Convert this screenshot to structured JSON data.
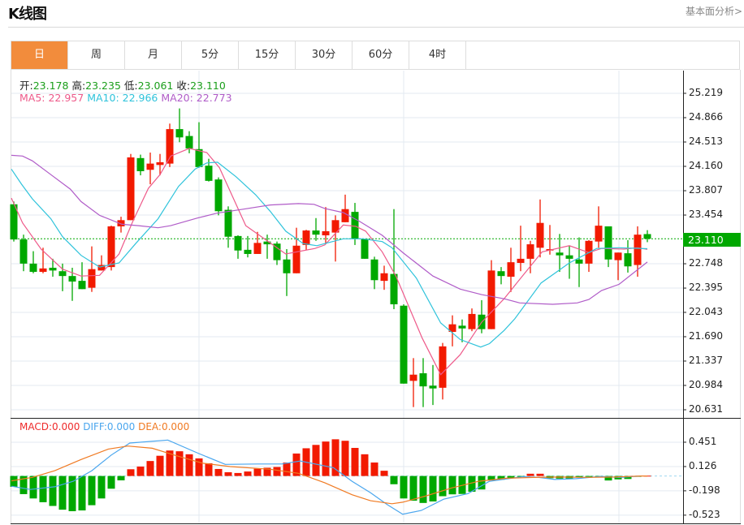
{
  "header": {
    "title": "K线图",
    "fundamental_link": "基本面分析>"
  },
  "tabs": [
    {
      "label": "日",
      "active": true
    },
    {
      "label": "周",
      "active": false
    },
    {
      "label": "月",
      "active": false
    },
    {
      "label": "5分",
      "active": false
    },
    {
      "label": "15分",
      "active": false
    },
    {
      "label": "30分",
      "active": false
    },
    {
      "label": "60分",
      "active": false
    },
    {
      "label": "4时",
      "active": false
    }
  ],
  "ohlc_info": {
    "open_label": "开:",
    "open": "23.178",
    "high_label": "高:",
    "high": "23.235",
    "low_label": "低:",
    "low": "23.061",
    "close_label": "收:",
    "close": "23.110"
  },
  "ma_info": {
    "ma5": "MA5: 22.957",
    "ma10": "MA10: 22.966",
    "ma20": "MA20: 22.773"
  },
  "macd_info": {
    "macd": "MACD:0.000",
    "diff": "DIFF:0.000",
    "dea": "DEA:0.000"
  },
  "colors": {
    "up": "#f21a00",
    "down": "#00a800",
    "ma5": "#ee5a8a",
    "ma10": "#2fc3db",
    "ma20": "#b05cc8",
    "diff": "#4aa6ee",
    "dea": "#f07a22",
    "tab_active": "#f28c3c"
  },
  "chart_data": [
    {
      "type": "candlestick",
      "title": "K线图",
      "current_price": "23.110",
      "yticks": [
        "25.219",
        "24.866",
        "24.513",
        "24.160",
        "23.807",
        "23.454",
        "22.748",
        "22.395",
        "22.043",
        "21.690",
        "21.337",
        "20.984",
        "20.631"
      ],
      "ylim": [
        20.631,
        25.219
      ],
      "candles": [
        [
          23.61,
          23.1,
          23.65,
          23.07
        ],
        [
          23.1,
          22.75,
          23.17,
          22.64
        ],
        [
          22.75,
          22.63,
          22.93,
          22.61
        ],
        [
          22.63,
          22.68,
          22.98,
          22.61
        ],
        [
          22.69,
          22.65,
          22.82,
          22.56
        ],
        [
          22.64,
          22.57,
          22.75,
          22.35
        ],
        [
          22.57,
          22.49,
          22.69,
          22.21
        ],
        [
          22.5,
          22.38,
          22.77,
          22.38
        ],
        [
          22.4,
          22.67,
          23.0,
          22.34
        ],
        [
          22.65,
          22.73,
          22.87,
          22.65
        ],
        [
          22.7,
          23.29,
          23.3,
          22.65
        ],
        [
          23.29,
          23.38,
          23.43,
          23.2
        ],
        [
          23.38,
          24.29,
          24.34,
          23.38
        ],
        [
          24.28,
          24.09,
          24.33,
          24.03
        ],
        [
          24.11,
          24.2,
          24.36,
          23.9
        ],
        [
          24.18,
          24.22,
          24.34,
          24.03
        ],
        [
          24.2,
          24.7,
          24.78,
          24.15
        ],
        [
          24.7,
          24.58,
          25.0,
          24.51
        ],
        [
          24.6,
          24.42,
          24.67,
          24.35
        ],
        [
          24.41,
          24.15,
          24.8,
          24.14
        ],
        [
          24.17,
          23.95,
          24.27,
          23.94
        ],
        [
          23.97,
          23.51,
          24.0,
          23.45
        ],
        [
          23.53,
          23.14,
          23.58,
          22.98
        ],
        [
          23.15,
          22.94,
          23.16,
          22.82
        ],
        [
          22.95,
          22.89,
          23.15,
          22.84
        ],
        [
          22.89,
          23.05,
          23.21,
          22.89
        ],
        [
          23.07,
          23.03,
          23.17,
          22.82
        ],
        [
          23.04,
          22.8,
          23.07,
          22.73
        ],
        [
          22.81,
          22.61,
          22.96,
          22.28
        ],
        [
          22.61,
          23.01,
          23.27,
          22.61
        ],
        [
          23.02,
          23.23,
          23.24,
          22.95
        ],
        [
          23.23,
          23.17,
          23.41,
          23.08
        ],
        [
          23.16,
          23.22,
          23.57,
          23.03
        ],
        [
          23.2,
          23.38,
          23.45,
          22.78
        ],
        [
          23.35,
          23.54,
          23.75,
          23.35
        ],
        [
          23.5,
          23.11,
          23.63,
          23.02
        ],
        [
          23.11,
          22.82,
          23.11,
          22.82
        ],
        [
          22.81,
          22.51,
          22.85,
          22.38
        ],
        [
          22.5,
          22.61,
          22.72,
          22.37
        ],
        [
          22.6,
          22.16,
          23.54,
          22.09
        ],
        [
          22.14,
          21.01,
          22.16,
          21.01
        ],
        [
          21.05,
          21.14,
          21.38,
          20.67
        ],
        [
          21.16,
          20.97,
          21.38,
          20.67
        ],
        [
          20.98,
          20.94,
          21.28,
          20.7
        ],
        [
          20.95,
          21.55,
          21.6,
          20.78
        ],
        [
          21.76,
          21.87,
          22.0,
          21.55
        ],
        [
          21.85,
          21.81,
          21.94,
          21.61
        ],
        [
          21.8,
          22.02,
          22.1,
          21.77
        ],
        [
          22.01,
          21.8,
          22.22,
          21.74
        ],
        [
          21.8,
          22.65,
          22.8,
          21.8
        ],
        [
          22.64,
          22.57,
          22.7,
          22.45
        ],
        [
          22.56,
          22.77,
          22.98,
          22.34
        ],
        [
          22.76,
          22.82,
          23.3,
          22.64
        ],
        [
          22.82,
          23.03,
          23.08,
          22.61
        ],
        [
          22.98,
          23.34,
          23.68,
          22.84
        ],
        [
          22.94,
          22.96,
          23.31,
          22.88
        ],
        [
          22.91,
          22.87,
          23.18,
          22.63
        ],
        [
          22.87,
          22.82,
          23.01,
          22.53
        ],
        [
          22.81,
          22.75,
          23.13,
          22.41
        ],
        [
          22.75,
          23.08,
          23.09,
          22.63
        ],
        [
          23.07,
          23.3,
          23.58,
          22.98
        ],
        [
          23.29,
          22.81,
          23.29,
          22.7
        ],
        [
          22.8,
          22.91,
          22.91,
          22.51
        ],
        [
          22.9,
          22.71,
          23.09,
          22.62
        ],
        [
          22.73,
          23.17,
          23.29,
          22.56
        ],
        [
          23.178,
          23.11,
          23.235,
          23.061
        ]
      ],
      "candle_fields": [
        "open",
        "close",
        "high",
        "low"
      ],
      "ma_series": [
        {
          "name": "MA5",
          "points": [
            [
              -0.3,
              23.7
            ],
            [
              0.9,
              23.34
            ],
            [
              2.8,
              22.96
            ],
            [
              5,
              22.67
            ],
            [
              6.9,
              22.57
            ],
            [
              8.8,
              22.58
            ],
            [
              10.8,
              22.89
            ],
            [
              12.2,
              23.36
            ],
            [
              13.8,
              23.84
            ],
            [
              15,
              24.04
            ],
            [
              16.1,
              24.31
            ],
            [
              18,
              24.42
            ],
            [
              19.8,
              24.36
            ],
            [
              21.1,
              24.14
            ],
            [
              23.8,
              23.3
            ],
            [
              26.7,
              23.01
            ],
            [
              27.9,
              22.89
            ],
            [
              30.9,
              22.97
            ],
            [
              31.9,
              23.02
            ],
            [
              33.8,
              23.31
            ],
            [
              35.1,
              23.29
            ],
            [
              36.1,
              23.22
            ],
            [
              37.8,
              22.92
            ],
            [
              39.2,
              22.57
            ],
            [
              41.9,
              21.67
            ],
            [
              43.8,
              21.14
            ],
            [
              45.8,
              21.43
            ],
            [
              48,
              21.9
            ],
            [
              50.3,
              22.24
            ],
            [
              51.9,
              22.52
            ],
            [
              54.2,
              22.92
            ],
            [
              57,
              23.01
            ],
            [
              59,
              22.91
            ],
            [
              60.3,
              22.97
            ],
            [
              62.6,
              22.96
            ],
            [
              64,
              22.98
            ],
            [
              65,
              22.957
            ]
          ]
        },
        {
          "name": "MA10",
          "points": [
            [
              -0.3,
              24.12
            ],
            [
              0.8,
              23.9
            ],
            [
              1.9,
              23.69
            ],
            [
              3.8,
              23.4
            ],
            [
              5,
              23.14
            ],
            [
              6.9,
              22.87
            ],
            [
              8.8,
              22.7
            ],
            [
              10.8,
              22.76
            ],
            [
              12.5,
              23.04
            ],
            [
              14.8,
              23.4
            ],
            [
              16.9,
              23.87
            ],
            [
              18.6,
              24.12
            ],
            [
              19.8,
              24.21
            ],
            [
              20.9,
              24.22
            ],
            [
              22.8,
              24.01
            ],
            [
              24.8,
              23.75
            ],
            [
              26.3,
              23.51
            ],
            [
              27.9,
              23.22
            ],
            [
              29.7,
              23.04
            ],
            [
              31.1,
              23.01
            ],
            [
              31.9,
              23.04
            ],
            [
              33.8,
              23.11
            ],
            [
              35.8,
              23.11
            ],
            [
              37.8,
              23.07
            ],
            [
              38.8,
              22.98
            ],
            [
              41.3,
              22.54
            ],
            [
              43.8,
              21.89
            ],
            [
              45.8,
              21.65
            ],
            [
              47.9,
              21.54
            ],
            [
              48.8,
              21.59
            ],
            [
              50.3,
              21.78
            ],
            [
              51.4,
              21.95
            ],
            [
              54.1,
              22.47
            ],
            [
              57,
              22.76
            ],
            [
              59.8,
              22.97
            ],
            [
              62.1,
              22.98
            ],
            [
              65,
              22.966
            ]
          ]
        },
        {
          "name": "MA20",
          "points": [
            [
              -0.3,
              24.32
            ],
            [
              0.9,
              24.31
            ],
            [
              1.9,
              24.24
            ],
            [
              3.8,
              24.04
            ],
            [
              5.8,
              23.83
            ],
            [
              6.9,
              23.65
            ],
            [
              8.8,
              23.45
            ],
            [
              11.1,
              23.32
            ],
            [
              12.8,
              23.3
            ],
            [
              14.8,
              23.27
            ],
            [
              16.1,
              23.3
            ],
            [
              18.8,
              23.41
            ],
            [
              20.8,
              23.48
            ],
            [
              23.6,
              23.54
            ],
            [
              26.3,
              23.6
            ],
            [
              29.2,
              23.62
            ],
            [
              30.8,
              23.61
            ],
            [
              31.9,
              23.55
            ],
            [
              33.8,
              23.49
            ],
            [
              35.5,
              23.36
            ],
            [
              37.8,
              23.16
            ],
            [
              40,
              22.9
            ],
            [
              43,
              22.57
            ],
            [
              45.8,
              22.38
            ],
            [
              48,
              22.3
            ],
            [
              50.3,
              22.24
            ],
            [
              51.9,
              22.18
            ],
            [
              55.3,
              22.16
            ],
            [
              57.8,
              22.18
            ],
            [
              59,
              22.23
            ],
            [
              60.3,
              22.36
            ],
            [
              62.1,
              22.45
            ],
            [
              65,
              22.773
            ]
          ]
        }
      ]
    },
    {
      "type": "bar",
      "title": "MACD",
      "yticks": [
        "0.451",
        "0.126",
        "-0.198",
        "-0.523"
      ],
      "histogram": [
        -0.144,
        -0.242,
        -0.3,
        -0.35,
        -0.4,
        -0.45,
        -0.47,
        -0.46,
        -0.39,
        -0.3,
        -0.17,
        -0.058,
        0.09,
        0.126,
        0.2,
        0.27,
        0.34,
        0.33,
        0.29,
        0.235,
        0.17,
        0.094,
        0.05,
        0.04,
        0.06,
        0.097,
        0.11,
        0.12,
        0.18,
        0.3,
        0.37,
        0.415,
        0.46,
        0.49,
        0.47,
        0.375,
        0.29,
        0.18,
        0.07,
        -0.11,
        -0.3,
        -0.33,
        -0.36,
        -0.34,
        -0.27,
        -0.245,
        -0.24,
        -0.21,
        -0.18,
        -0.06,
        -0.05,
        -0.025,
        -0.007,
        0.03,
        0.03,
        -0.03,
        -0.035,
        -0.035,
        -0.02,
        -0.01,
        -0.005,
        -0.06,
        -0.045,
        -0.04,
        -0.007,
        0.004
      ],
      "diff": [
        [
          -0.25,
          -0.137
        ],
        [
          1.7,
          -0.18
        ],
        [
          4.2,
          -0.144
        ],
        [
          6.1,
          -0.07
        ],
        [
          8,
          0.07
        ],
        [
          10,
          0.28
        ],
        [
          11.9,
          0.44
        ],
        [
          15.8,
          0.48
        ],
        [
          18.8,
          0.31
        ],
        [
          21.7,
          0.155
        ],
        [
          25,
          0.16
        ],
        [
          27.5,
          0.16
        ],
        [
          29.4,
          0.2
        ],
        [
          32.8,
          0.11
        ],
        [
          34.7,
          -0.07
        ],
        [
          36.6,
          -0.224
        ],
        [
          38.3,
          -0.38
        ],
        [
          39.9,
          -0.51
        ],
        [
          41.8,
          -0.46
        ],
        [
          44.1,
          -0.31
        ],
        [
          46.6,
          -0.235
        ],
        [
          48.8,
          -0.07
        ],
        [
          52.2,
          -0.01
        ],
        [
          53.8,
          -0.018
        ],
        [
          55.5,
          -0.047
        ],
        [
          57.7,
          -0.036
        ],
        [
          60.2,
          -0.007
        ],
        [
          62.2,
          -0.02
        ],
        [
          64.3,
          0
        ]
      ],
      "dea": [
        [
          -0.25,
          -0.065
        ],
        [
          1.9,
          -0.018
        ],
        [
          4.2,
          0.07
        ],
        [
          6.9,
          0.22
        ],
        [
          9.7,
          0.36
        ],
        [
          11.7,
          0.4
        ],
        [
          14.2,
          0.37
        ],
        [
          16.7,
          0.27
        ],
        [
          19.4,
          0.17
        ],
        [
          22.2,
          0.126
        ],
        [
          26.3,
          0.09
        ],
        [
          29.2,
          0.036
        ],
        [
          31.9,
          -0.09
        ],
        [
          34.7,
          -0.25
        ],
        [
          36.6,
          -0.33
        ],
        [
          38.8,
          -0.37
        ],
        [
          39.9,
          -0.35
        ],
        [
          42.2,
          -0.27
        ],
        [
          44.9,
          -0.16
        ],
        [
          47.7,
          -0.07
        ],
        [
          50.5,
          -0.03
        ],
        [
          53.3,
          -0.02
        ],
        [
          56,
          -0.014
        ],
        [
          58.8,
          -0.018
        ],
        [
          61.6,
          -0.014
        ],
        [
          64.3,
          0
        ],
        [
          65,
          0
        ]
      ]
    }
  ]
}
